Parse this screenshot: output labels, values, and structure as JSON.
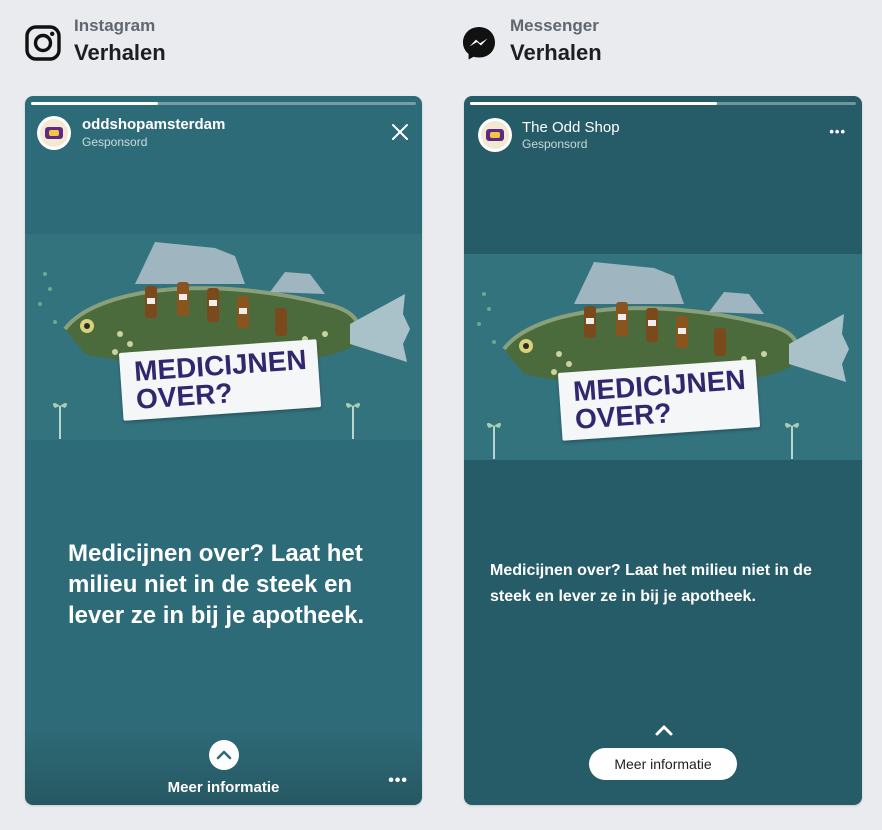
{
  "instagram": {
    "app_name": "Instagram",
    "section": "Verhalen",
    "account": "oddshopamsterdam",
    "sponsored": "Gesponsord",
    "progress": 0.33,
    "sign_text_line1": "MEDICIJNEN",
    "sign_text_line2": "OVER?",
    "caption": "Medicijnen over? Laat het milieu niet in de steek en lever ze in bij je apotheek.",
    "cta": "Meer informatie",
    "more": "•••"
  },
  "messenger": {
    "app_name": "Messenger",
    "section": "Verhalen",
    "account": "The Odd Shop",
    "sponsored": "Gesponsord",
    "progress": 0.64,
    "sign_text_line1": "MEDICIJNEN",
    "sign_text_line2": "OVER?",
    "caption": "Medicijnen over? Laat het milieu niet in de steek en lever ze in bij je apotheek.",
    "cta": "Meer informatie",
    "more": "•••"
  },
  "icons": {
    "instagram_logo": "instagram-icon",
    "messenger_logo": "messenger-icon",
    "close": "close-icon",
    "chevron_up": "chevron-up-icon",
    "more": "more-icon"
  },
  "colors": {
    "background": "#e9ebee",
    "ig_story_bg": "#2e6b78",
    "ms_story_bg": "#255c68",
    "sign_text": "#31276e"
  }
}
